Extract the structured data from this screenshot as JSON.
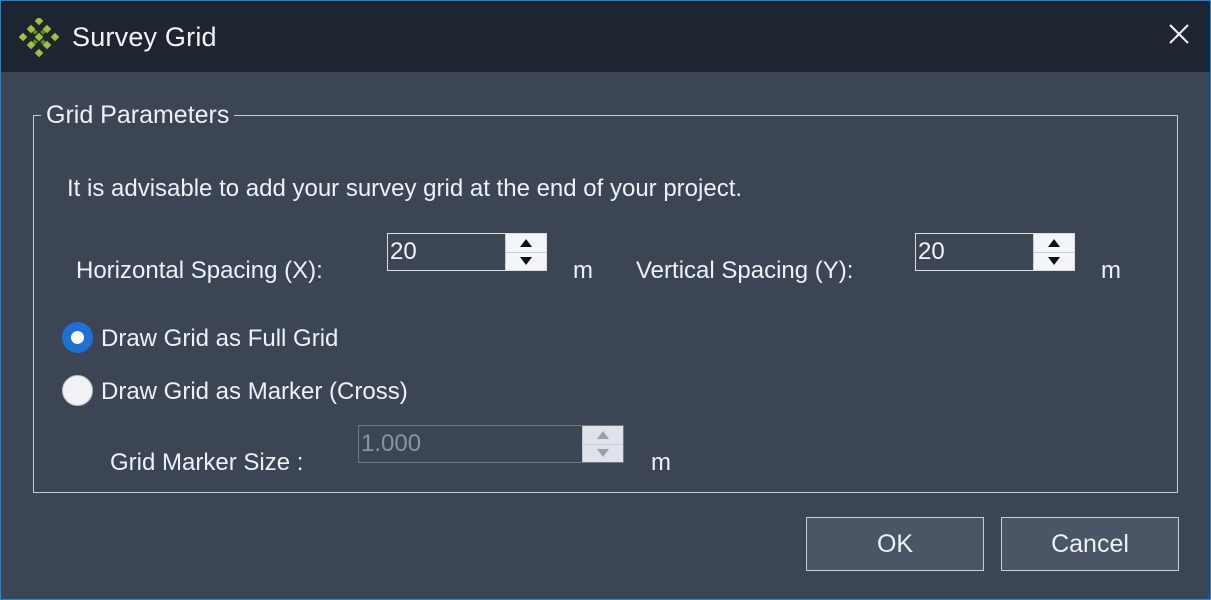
{
  "window": {
    "title": "Survey Grid"
  },
  "group": {
    "legend": "Grid Parameters",
    "advice": "It is advisable to add your survey grid at the end of your project."
  },
  "horizontal": {
    "label": "Horizontal Spacing (X):",
    "value": "20",
    "unit": "m"
  },
  "vertical": {
    "label": "Vertical Spacing (Y):",
    "value": "20",
    "unit": "m"
  },
  "options": {
    "full_grid": {
      "label": "Draw Grid as Full Grid",
      "checked": true
    },
    "marker": {
      "label": "Draw Grid as Marker (Cross)",
      "checked": false
    }
  },
  "marker_size": {
    "label": "Grid Marker Size :",
    "value": "1.000",
    "unit": "m",
    "enabled": false
  },
  "buttons": {
    "ok": "OK",
    "cancel": "Cancel"
  },
  "colors": {
    "accent": "#1e6fd6",
    "window_border": "#1e88d8",
    "body_bg": "#3b4554",
    "titlebar_bg": "#1f2530",
    "icon_green": "#9bc53d"
  },
  "icons": {
    "app": "survey-grid-icon",
    "close": "close-icon",
    "spin_up": "triangle-up-icon",
    "spin_down": "triangle-down-icon"
  }
}
